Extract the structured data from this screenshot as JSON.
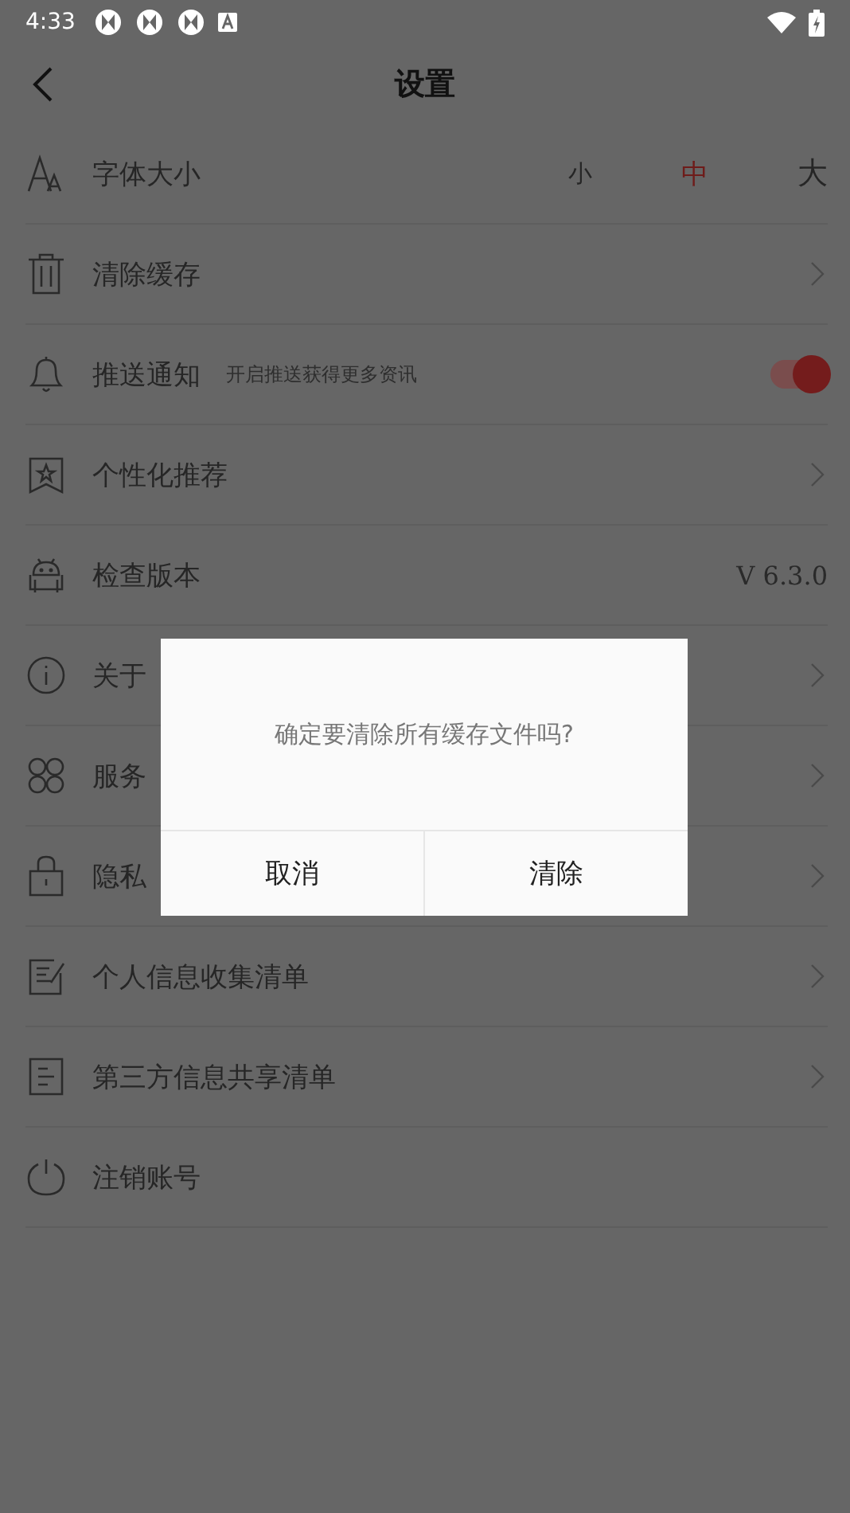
{
  "status_bar": {
    "time": "4:33"
  },
  "header": {
    "title": "设置"
  },
  "rows": [
    {
      "kind": "font_size",
      "label": "字体大小",
      "options": [
        {
          "label": "小",
          "selected": false
        },
        {
          "label": "中",
          "selected": true
        },
        {
          "label": "大",
          "selected": false
        }
      ]
    },
    {
      "kind": "link",
      "label": "清除缓存"
    },
    {
      "kind": "toggle",
      "label": "推送通知",
      "hint": "开启推送获得更多资讯",
      "on": true
    },
    {
      "kind": "link",
      "label": "个性化推荐"
    },
    {
      "kind": "value",
      "label": "检查版本",
      "value": "V 6.3.0"
    },
    {
      "kind": "link",
      "label": "关于"
    },
    {
      "kind": "link",
      "label": "服务"
    },
    {
      "kind": "link",
      "label": "隐私"
    },
    {
      "kind": "link",
      "label": "个人信息收集清单"
    },
    {
      "kind": "link",
      "label": "第三方信息共享清单"
    },
    {
      "kind": "plain",
      "label": "注销账号"
    }
  ],
  "dialog": {
    "message": "确定要清除所有缓存文件吗?",
    "buttons": [
      "取消",
      "清除"
    ]
  }
}
